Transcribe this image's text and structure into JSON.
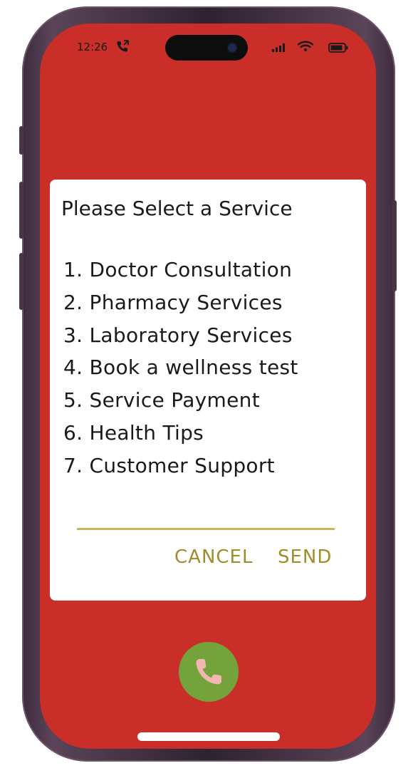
{
  "status_bar": {
    "time": "12:26"
  },
  "dialog": {
    "title": "Please Select a Service",
    "items": [
      {
        "label": "1. Doctor Consultation"
      },
      {
        "label": "2. Pharmacy Services"
      },
      {
        "label": "3. Laboratory Services"
      },
      {
        "label": "4. Book a wellness test"
      },
      {
        "label": "5. Service Payment"
      },
      {
        "label": "6. Health Tips"
      },
      {
        "label": "7. Customer Support"
      }
    ],
    "input_value": "",
    "cancel_label": "CANCEL",
    "send_label": "SEND"
  },
  "colors": {
    "screen_background": "#c92e28",
    "dialog_accent": "#a08d2a",
    "input_underline": "#c9b75a",
    "call_button": "#73a33a",
    "call_icon": "#f2b8b0"
  },
  "icons": {
    "call_status": "phone-call-icon",
    "signal": "cellular-signal-icon",
    "wifi": "wifi-icon",
    "battery": "battery-icon",
    "call_button": "phone-handset-icon"
  }
}
